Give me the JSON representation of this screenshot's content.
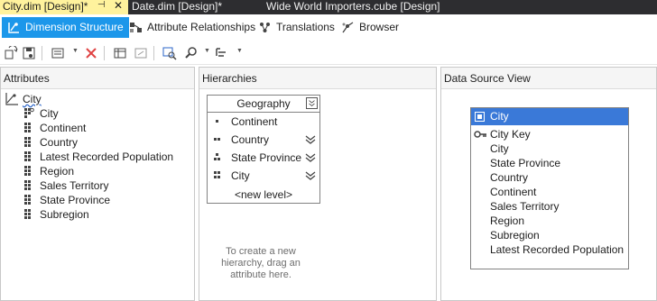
{
  "document_tabs": [
    {
      "label": "City.dim [Design]*",
      "active": true
    },
    {
      "label": "Date.dim [Design]*",
      "active": false
    },
    {
      "label": "Wide World Importers.cube [Design]",
      "active": false
    }
  ],
  "designer_tabs": [
    {
      "label": "Dimension Structure",
      "icon": "dimension-structure-icon",
      "selected": true
    },
    {
      "label": "Attribute Relationships",
      "icon": "attribute-relationships-icon",
      "selected": false
    },
    {
      "label": "Translations",
      "icon": "translations-icon",
      "selected": false
    },
    {
      "label": "Browser",
      "icon": "browser-icon",
      "selected": false
    }
  ],
  "attributes_pane": {
    "title": "Attributes",
    "root": "City",
    "items": [
      "City",
      "Continent",
      "Country",
      "Latest Recorded Population",
      "Region",
      "Sales Territory",
      "State Province",
      "Subregion"
    ]
  },
  "hierarchies_pane": {
    "title": "Hierarchies",
    "hierarchy_name": "Geography",
    "levels": [
      "Continent",
      "Country",
      "State Province",
      "City"
    ],
    "new_level": "<new level>",
    "hint": "To create a new hierarchy, drag an attribute here."
  },
  "dsv_pane": {
    "title": "Data Source View",
    "table_name": "City",
    "columns": [
      "City Key",
      "City",
      "State Province",
      "Country",
      "Continent",
      "Sales Territory",
      "Region",
      "Subregion",
      "Latest Recorded Population"
    ]
  },
  "colors": {
    "active_tab": "#fff29d",
    "selected_designer_tab": "#1c97ea",
    "dsv_title": "#3a79d8"
  }
}
